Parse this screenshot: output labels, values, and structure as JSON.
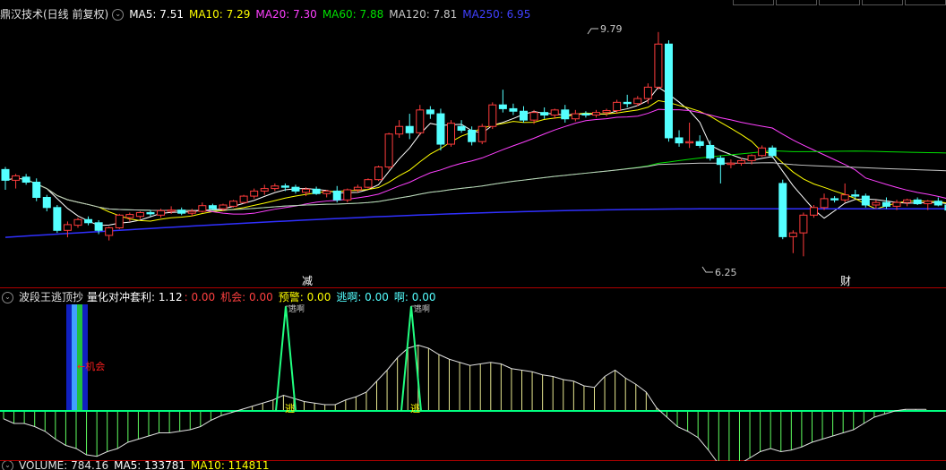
{
  "main_header": {
    "title": "鼎汉技术(日线 前复权)",
    "ma5": "MA5: 7.51",
    "ma10": "MA10: 7.29",
    "ma20": "MA20: 7.30",
    "ma60": "MA60: 7.88",
    "ma120": "MA120: 7.81",
    "ma250": "MA250: 6.95"
  },
  "price_labels": {
    "high": "9.79",
    "low": "6.25"
  },
  "markers": {
    "reduce": "减",
    "finance": "财"
  },
  "indicator_header": {
    "name": "波段王逃顶抄",
    "param": "量化对冲套利: 1.12",
    "v1": ": 0.00",
    "chance": "机会: 0.00",
    "warning": "预警: 0.00",
    "escape": "逃啊: 0.00",
    "ah": "啊: 0.00"
  },
  "indicator_labels": {
    "chance": "←机会",
    "escape": "逃",
    "escape_ah": "逃啊"
  },
  "volume_header": {
    "volume": "VOLUME: 784.16",
    "ma5": "MA5: 133781",
    "ma10": "MA10: 114811"
  },
  "colors": {
    "up": "#ff3c3c",
    "down": "#54ffff",
    "ma5": "#ffffff",
    "ma10": "#ffff00",
    "ma20": "#ff40ff",
    "ma60": "#00e000",
    "ma120": "#c8c8c8",
    "ma250": "#3030ff",
    "border": "#b00000"
  },
  "chart_data": {
    "type": "candlestick",
    "ylim": [
      6.0,
      9.9
    ],
    "candles": [
      {
        "o": 7.62,
        "h": 7.66,
        "l": 7.3,
        "c": 7.45
      },
      {
        "o": 7.45,
        "h": 7.55,
        "l": 7.32,
        "c": 7.52
      },
      {
        "o": 7.5,
        "h": 7.55,
        "l": 7.38,
        "c": 7.42
      },
      {
        "o": 7.42,
        "h": 7.48,
        "l": 7.12,
        "c": 7.18
      },
      {
        "o": 7.18,
        "h": 7.22,
        "l": 6.96,
        "c": 7.02
      },
      {
        "o": 7.02,
        "h": 7.06,
        "l": 6.62,
        "c": 6.66
      },
      {
        "o": 6.66,
        "h": 6.8,
        "l": 6.55,
        "c": 6.75
      },
      {
        "o": 6.74,
        "h": 6.86,
        "l": 6.7,
        "c": 6.83
      },
      {
        "o": 6.83,
        "h": 6.88,
        "l": 6.74,
        "c": 6.78
      },
      {
        "o": 6.78,
        "h": 6.82,
        "l": 6.6,
        "c": 6.66
      },
      {
        "o": 6.58,
        "h": 6.72,
        "l": 6.5,
        "c": 6.7
      },
      {
        "o": 6.7,
        "h": 6.92,
        "l": 6.68,
        "c": 6.9
      },
      {
        "o": 6.86,
        "h": 6.94,
        "l": 6.8,
        "c": 6.91
      },
      {
        "o": 6.88,
        "h": 6.96,
        "l": 6.84,
        "c": 6.94
      },
      {
        "o": 6.94,
        "h": 6.98,
        "l": 6.88,
        "c": 6.92
      },
      {
        "o": 6.9,
        "h": 7.0,
        "l": 6.86,
        "c": 6.97
      },
      {
        "o": 6.96,
        "h": 7.04,
        "l": 6.92,
        "c": 6.98
      },
      {
        "o": 6.98,
        "h": 7.02,
        "l": 6.9,
        "c": 6.93
      },
      {
        "o": 6.93,
        "h": 7.0,
        "l": 6.88,
        "c": 6.96
      },
      {
        "o": 6.96,
        "h": 7.1,
        "l": 6.94,
        "c": 7.05
      },
      {
        "o": 7.05,
        "h": 7.08,
        "l": 6.98,
        "c": 7.0
      },
      {
        "o": 7.0,
        "h": 7.08,
        "l": 6.96,
        "c": 7.06
      },
      {
        "o": 7.04,
        "h": 7.14,
        "l": 7.02,
        "c": 7.12
      },
      {
        "o": 7.1,
        "h": 7.22,
        "l": 7.08,
        "c": 7.2
      },
      {
        "o": 7.2,
        "h": 7.32,
        "l": 7.16,
        "c": 7.28
      },
      {
        "o": 7.28,
        "h": 7.38,
        "l": 7.22,
        "c": 7.32
      },
      {
        "o": 7.32,
        "h": 7.4,
        "l": 7.28,
        "c": 7.36
      },
      {
        "o": 7.36,
        "h": 7.4,
        "l": 7.28,
        "c": 7.34
      },
      {
        "o": 7.34,
        "h": 7.38,
        "l": 7.24,
        "c": 7.28
      },
      {
        "o": 7.26,
        "h": 7.34,
        "l": 7.2,
        "c": 7.31
      },
      {
        "o": 7.31,
        "h": 7.35,
        "l": 7.22,
        "c": 7.24
      },
      {
        "o": 7.24,
        "h": 7.3,
        "l": 7.18,
        "c": 7.28
      },
      {
        "o": 7.28,
        "h": 7.36,
        "l": 7.1,
        "c": 7.14
      },
      {
        "o": 7.14,
        "h": 7.32,
        "l": 7.1,
        "c": 7.3
      },
      {
        "o": 7.3,
        "h": 7.38,
        "l": 7.26,
        "c": 7.34
      },
      {
        "o": 7.34,
        "h": 7.48,
        "l": 7.32,
        "c": 7.46
      },
      {
        "o": 7.46,
        "h": 7.68,
        "l": 7.44,
        "c": 7.66
      },
      {
        "o": 7.66,
        "h": 8.2,
        "l": 7.62,
        "c": 8.18
      },
      {
        "o": 8.18,
        "h": 8.4,
        "l": 8.12,
        "c": 8.3
      },
      {
        "o": 8.3,
        "h": 8.5,
        "l": 8.1,
        "c": 8.2
      },
      {
        "o": 8.2,
        "h": 8.64,
        "l": 8.16,
        "c": 8.56
      },
      {
        "o": 8.56,
        "h": 8.62,
        "l": 8.42,
        "c": 8.5
      },
      {
        "o": 8.5,
        "h": 8.58,
        "l": 7.92,
        "c": 8.02
      },
      {
        "o": 8.02,
        "h": 8.4,
        "l": 7.98,
        "c": 8.35
      },
      {
        "o": 8.3,
        "h": 8.4,
        "l": 8.2,
        "c": 8.24
      },
      {
        "o": 8.24,
        "h": 8.3,
        "l": 8.0,
        "c": 8.06
      },
      {
        "o": 8.06,
        "h": 8.34,
        "l": 8.02,
        "c": 8.3
      },
      {
        "o": 8.3,
        "h": 8.68,
        "l": 8.26,
        "c": 8.64
      },
      {
        "o": 8.64,
        "h": 8.88,
        "l": 8.52,
        "c": 8.58
      },
      {
        "o": 8.58,
        "h": 8.66,
        "l": 8.48,
        "c": 8.54
      },
      {
        "o": 8.54,
        "h": 8.62,
        "l": 8.36,
        "c": 8.4
      },
      {
        "o": 8.4,
        "h": 8.56,
        "l": 8.34,
        "c": 8.52
      },
      {
        "o": 8.52,
        "h": 8.6,
        "l": 8.42,
        "c": 8.48
      },
      {
        "o": 8.48,
        "h": 8.58,
        "l": 8.42,
        "c": 8.56
      },
      {
        "o": 8.56,
        "h": 8.64,
        "l": 8.36,
        "c": 8.42
      },
      {
        "o": 8.42,
        "h": 8.56,
        "l": 8.38,
        "c": 8.5
      },
      {
        "o": 8.5,
        "h": 8.54,
        "l": 8.44,
        "c": 8.48
      },
      {
        "o": 8.48,
        "h": 8.56,
        "l": 8.44,
        "c": 8.52
      },
      {
        "o": 8.52,
        "h": 8.58,
        "l": 8.46,
        "c": 8.55
      },
      {
        "o": 8.55,
        "h": 8.72,
        "l": 8.5,
        "c": 8.68
      },
      {
        "o": 8.68,
        "h": 8.8,
        "l": 8.6,
        "c": 8.66
      },
      {
        "o": 8.66,
        "h": 8.78,
        "l": 8.62,
        "c": 8.74
      },
      {
        "o": 8.74,
        "h": 8.98,
        "l": 8.66,
        "c": 8.92
      },
      {
        "o": 8.92,
        "h": 9.79,
        "l": 8.88,
        "c": 9.6
      },
      {
        "o": 9.6,
        "h": 9.66,
        "l": 8.06,
        "c": 8.12
      },
      {
        "o": 8.12,
        "h": 8.24,
        "l": 7.98,
        "c": 8.04
      },
      {
        "o": 8.04,
        "h": 8.36,
        "l": 7.96,
        "c": 8.06
      },
      {
        "o": 8.06,
        "h": 8.16,
        "l": 7.96,
        "c": 8.0
      },
      {
        "o": 8.0,
        "h": 8.08,
        "l": 7.76,
        "c": 7.8
      },
      {
        "o": 7.8,
        "h": 7.84,
        "l": 7.4,
        "c": 7.7
      },
      {
        "o": 7.7,
        "h": 7.78,
        "l": 7.64,
        "c": 7.72
      },
      {
        "o": 7.72,
        "h": 7.8,
        "l": 7.68,
        "c": 7.76
      },
      {
        "o": 7.76,
        "h": 7.86,
        "l": 7.7,
        "c": 7.84
      },
      {
        "o": 7.84,
        "h": 8.0,
        "l": 7.82,
        "c": 7.96
      },
      {
        "o": 7.96,
        "h": 8.0,
        "l": 7.8,
        "c": 7.84
      },
      {
        "o": 7.4,
        "h": 7.46,
        "l": 6.52,
        "c": 6.56
      },
      {
        "o": 6.56,
        "h": 6.66,
        "l": 6.3,
        "c": 6.62
      },
      {
        "o": 6.62,
        "h": 6.94,
        "l": 6.25,
        "c": 6.9
      },
      {
        "o": 6.9,
        "h": 7.06,
        "l": 6.86,
        "c": 7.02
      },
      {
        "o": 7.02,
        "h": 7.24,
        "l": 6.98,
        "c": 7.16
      },
      {
        "o": 7.16,
        "h": 7.2,
        "l": 7.1,
        "c": 7.14
      },
      {
        "o": 7.14,
        "h": 7.4,
        "l": 7.1,
        "c": 7.22
      },
      {
        "o": 7.22,
        "h": 7.3,
        "l": 7.16,
        "c": 7.2
      },
      {
        "o": 7.2,
        "h": 7.24,
        "l": 7.02,
        "c": 7.06
      },
      {
        "o": 7.06,
        "h": 7.14,
        "l": 7.0,
        "c": 7.1
      },
      {
        "o": 7.1,
        "h": 7.18,
        "l": 7.0,
        "c": 7.04
      },
      {
        "o": 7.04,
        "h": 7.14,
        "l": 6.98,
        "c": 7.1
      },
      {
        "o": 7.1,
        "h": 7.16,
        "l": 7.04,
        "c": 7.14
      },
      {
        "o": 7.14,
        "h": 7.18,
        "l": 7.06,
        "c": 7.08
      },
      {
        "o": 7.08,
        "h": 7.14,
        "l": 6.98,
        "c": 7.12
      },
      {
        "o": 7.12,
        "h": 7.18,
        "l": 7.04,
        "c": 7.06
      },
      {
        "o": 7.06,
        "h": 7.1,
        "l": 6.94,
        "c": 6.98
      },
      {
        "o": 6.74,
        "h": 6.86,
        "l": 6.7,
        "c": 6.8
      },
      {
        "o": 6.8,
        "h": 6.9,
        "l": 6.76,
        "c": 6.84
      },
      {
        "o": 6.92,
        "h": 7.04,
        "l": 6.9,
        "c": 7.02
      },
      {
        "o": 7.02,
        "h": 7.1,
        "l": 6.96,
        "c": 7.06
      },
      {
        "o": 7.06,
        "h": 7.24,
        "l": 7.02,
        "c": 7.2
      },
      {
        "o": 7.2,
        "h": 7.24,
        "l": 7.1,
        "c": 7.14
      },
      {
        "o": 7.14,
        "h": 7.4,
        "l": 7.1,
        "c": 7.32
      },
      {
        "o": 7.38,
        "h": 7.44,
        "l": 7.22,
        "c": 7.26
      },
      {
        "o": 7.26,
        "h": 7.32,
        "l": 7.18,
        "c": 7.22
      }
    ],
    "indicator_line": [
      -5,
      -8,
      -8,
      -10,
      -13,
      -18,
      -22,
      -24,
      -28,
      -29,
      -26,
      -24,
      -20,
      -18,
      -16,
      -14,
      -14,
      -13,
      -12,
      -10,
      -6,
      -3,
      -1,
      1,
      3,
      5,
      7,
      10,
      8,
      6,
      5,
      4,
      4,
      7,
      9,
      12,
      19,
      26,
      34,
      40,
      42,
      40,
      36,
      33,
      31,
      29,
      30,
      31,
      30,
      27,
      26,
      25,
      23,
      22,
      20,
      19,
      16,
      15,
      22,
      26,
      21,
      17,
      12,
      2,
      -4,
      -10,
      -13,
      -17,
      -25,
      -34,
      -35,
      -34,
      -30,
      -26,
      -24,
      -26,
      -25,
      -23,
      -20,
      -18,
      -16,
      -14,
      -12,
      -8,
      -4,
      -2,
      0,
      1,
      1,
      1
    ],
    "chance_signal_index": 4,
    "escape_signal_indices": [
      36,
      60
    ]
  }
}
